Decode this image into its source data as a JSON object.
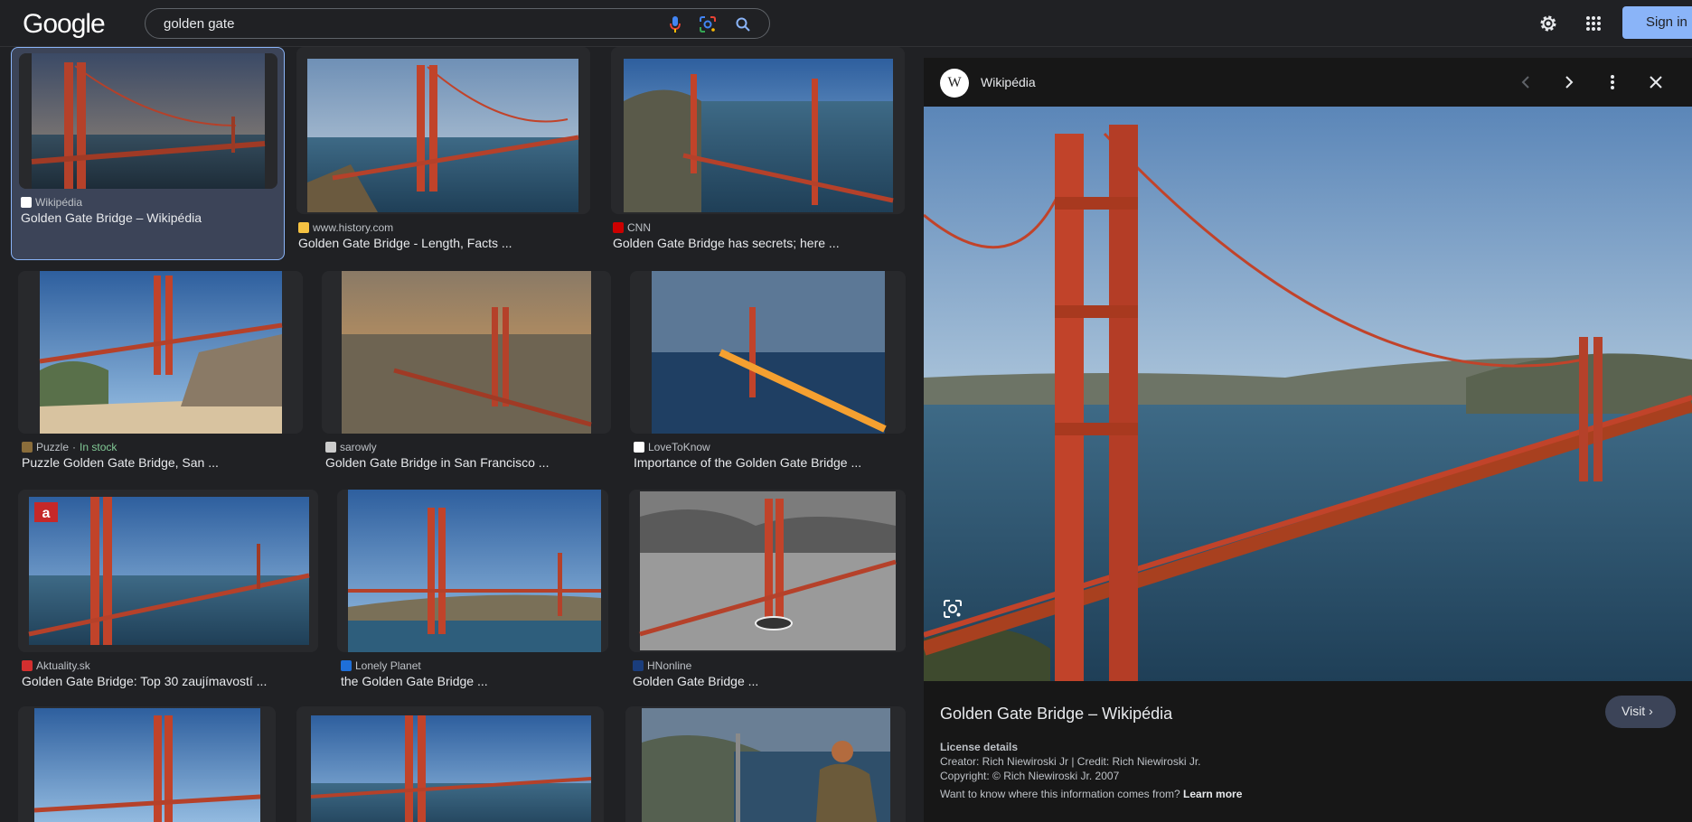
{
  "header": {
    "logo": "Google",
    "query": "golden gate",
    "signin_label": "Sign in"
  },
  "results": [
    {
      "source": "Wikipédia",
      "title": "Golden Gate Bridge – Wikipédia",
      "fav_color": "#ffffff"
    },
    {
      "source": "www.history.com",
      "title": "Golden Gate Bridge - Length, Facts ...",
      "fav_color": "#f5c242"
    },
    {
      "source": "CNN",
      "title": "Golden Gate Bridge has secrets; here ...",
      "fav_color": "#cc0000"
    },
    {
      "source": "Puzzle",
      "source_extra": "In stock",
      "title": "Puzzle Golden Gate Bridge, San ...",
      "fav_color": "#8a6d3b"
    },
    {
      "source": "sarowly",
      "title": "Golden Gate Bridge in San Francisco ...",
      "fav_color": "#cccccc"
    },
    {
      "source": "LoveToKnow",
      "title": "Importance of the Golden Gate Bridge ...",
      "fav_color": "#ffffff"
    },
    {
      "source": "Aktuality.sk",
      "title": "Golden Gate Bridge: Top 30 zaujímavostí ...",
      "fav_color": "#d32f2f"
    },
    {
      "source": "Lonely Planet",
      "title": "the Golden Gate Bridge ...",
      "fav_color": "#1e6fd9"
    },
    {
      "source": "HNonline",
      "title": "Golden Gate Bridge ...",
      "fav_color": "#1a3d7c"
    }
  ],
  "panel": {
    "site": "Wikipédia",
    "logo_letter": "W",
    "title": "Golden Gate Bridge – Wikipédia",
    "visit_label": "Visit",
    "license_heading": "License details",
    "license_line1": "Creator: Rich Niewiroski Jr | Credit: Rich Niewiroski Jr.",
    "license_line2": "Copyright: © Rich Niewiroski Jr. 2007",
    "info_text": "Want to know where this information comes from?",
    "learn_more": "Learn more"
  },
  "colors": {
    "accent": "#8ab4f8",
    "bridge": "#c1432a",
    "background": "#202124"
  },
  "icons": [
    "mic-icon",
    "google-lens-icon",
    "search-icon",
    "settings-gear-icon",
    "apps-grid-icon",
    "chevron-left-icon",
    "chevron-right-icon",
    "more-vert-icon",
    "close-icon",
    "lens-icon"
  ]
}
